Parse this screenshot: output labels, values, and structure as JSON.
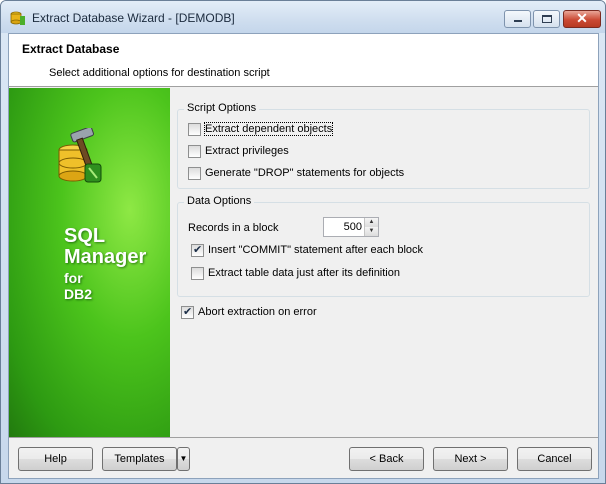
{
  "window": {
    "title": "Extract Database Wizard - [DEMODB]",
    "close_glyph": "✕"
  },
  "header": {
    "title": "Extract Database",
    "subtitle": "Select additional options for destination script"
  },
  "sidebar": {
    "line1": "SQL",
    "line2": "Manager",
    "line3": "for",
    "line4": "DB2",
    "logo_icon": "database-hammer-icon",
    "bg_color": "#3db21a"
  },
  "script_options": {
    "label": "Script Options",
    "items": [
      {
        "label": "Extract dependent objects",
        "checked": false
      },
      {
        "label": "Extract privileges",
        "checked": false
      },
      {
        "label": "Generate \"DROP\" statements for objects",
        "checked": false
      }
    ]
  },
  "data_options": {
    "label": "Data Options",
    "records_label": "Records in a block",
    "records_value": "500",
    "commit_label": "Insert \"COMMIT\" statement after each block",
    "commit_checked": true,
    "extract_after_label": "Extract table data just after its definition",
    "extract_after_checked": false
  },
  "abort": {
    "label": "Abort extraction on error",
    "checked": true
  },
  "buttons": {
    "help": "Help",
    "templates": "Templates",
    "templates_arrow": "▼",
    "back": "< Back",
    "next": "Next >",
    "cancel": "Cancel"
  }
}
